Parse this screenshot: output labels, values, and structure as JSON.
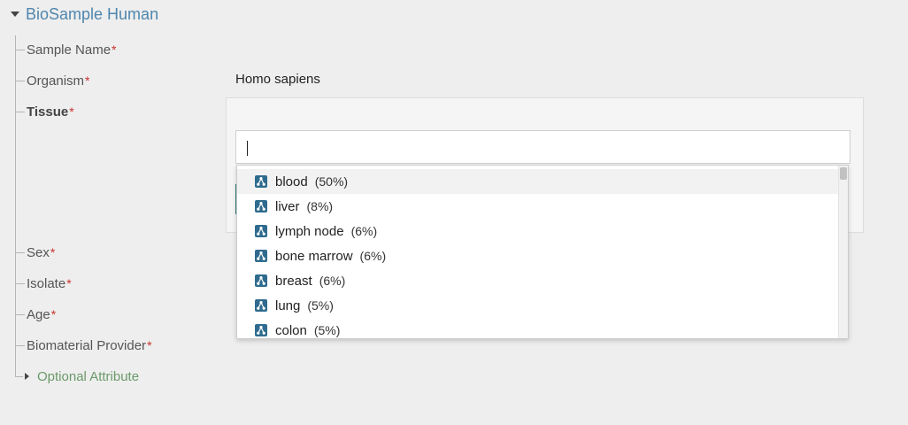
{
  "section": {
    "title": "BioSample Human"
  },
  "required_marker": "*",
  "fields": {
    "sample_name": {
      "label": "Sample Name"
    },
    "organism": {
      "label": "Organism",
      "value": "Homo sapiens"
    },
    "tissue": {
      "label": "Tissue",
      "input_value": ""
    },
    "sex": {
      "label": "Sex"
    },
    "isolate": {
      "label": "Isolate"
    },
    "age": {
      "label": "Age"
    },
    "biomaterial_provider": {
      "label": "Biomaterial Provider"
    }
  },
  "dropdown": {
    "items": [
      {
        "term": "blood",
        "pct": "(50%)"
      },
      {
        "term": "liver",
        "pct": "(8%)"
      },
      {
        "term": "lymph node",
        "pct": "(6%)"
      },
      {
        "term": "bone marrow",
        "pct": "(6%)"
      },
      {
        "term": "breast",
        "pct": "(6%)"
      },
      {
        "term": "lung",
        "pct": "(5%)"
      },
      {
        "term": "colon",
        "pct": "(5%)"
      }
    ],
    "icon": "ontology-tree-icon",
    "icon_color": "#2f6b8e"
  },
  "optional": {
    "label": "Optional Attribute"
  },
  "colors": {
    "title": "#4f86ad",
    "required": "#c9302c",
    "optional": "#6a9a6a",
    "accent": "#2f7f7a"
  }
}
